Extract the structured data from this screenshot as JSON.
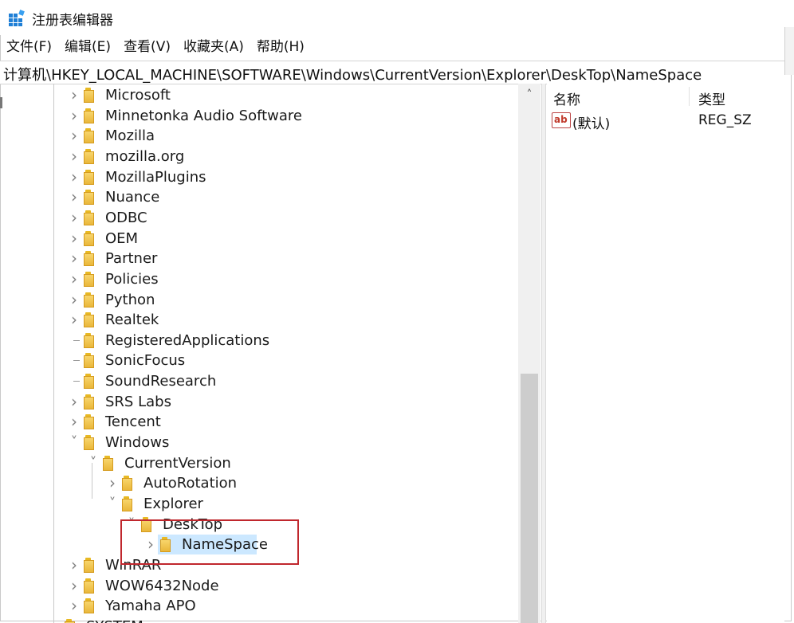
{
  "window": {
    "title": "注册表编辑器"
  },
  "menu": [
    "文件(F)",
    "编辑(E)",
    "查看(V)",
    "收藏夹(A)",
    "帮助(H)"
  ],
  "address": "计算机\\HKEY_LOCAL_MACHINE\\SOFTWARE\\Windows\\CurrentVersion\\Explorer\\DeskTop\\NameSpace",
  "tree": [
    {
      "label": "Microsoft",
      "level": 0,
      "state": "collapsed"
    },
    {
      "label": "Minnetonka Audio Software",
      "level": 0,
      "state": "collapsed"
    },
    {
      "label": "Mozilla",
      "level": 0,
      "state": "collapsed"
    },
    {
      "label": "mozilla.org",
      "level": 0,
      "state": "collapsed"
    },
    {
      "label": "MozillaPlugins",
      "level": 0,
      "state": "collapsed"
    },
    {
      "label": "Nuance",
      "level": 0,
      "state": "collapsed"
    },
    {
      "label": "ODBC",
      "level": 0,
      "state": "collapsed"
    },
    {
      "label": "OEM",
      "level": 0,
      "state": "collapsed"
    },
    {
      "label": "Partner",
      "level": 0,
      "state": "collapsed"
    },
    {
      "label": "Policies",
      "level": 0,
      "state": "collapsed"
    },
    {
      "label": "Python",
      "level": 0,
      "state": "collapsed"
    },
    {
      "label": "Realtek",
      "level": 0,
      "state": "collapsed"
    },
    {
      "label": "RegisteredApplications",
      "level": 0,
      "state": "leaf"
    },
    {
      "label": "SonicFocus",
      "level": 0,
      "state": "leaf"
    },
    {
      "label": "SoundResearch",
      "level": 0,
      "state": "leaf"
    },
    {
      "label": "SRS Labs",
      "level": 0,
      "state": "collapsed"
    },
    {
      "label": "Tencent",
      "level": 0,
      "state": "collapsed"
    },
    {
      "label": "Windows",
      "level": 0,
      "state": "expanded"
    },
    {
      "label": "CurrentVersion",
      "level": 1,
      "state": "expanded"
    },
    {
      "label": "AutoRotation",
      "level": 2,
      "state": "collapsed"
    },
    {
      "label": "Explorer",
      "level": 2,
      "state": "expanded"
    },
    {
      "label": "DeskTop",
      "level": 3,
      "state": "expanded"
    },
    {
      "label": "NameSpace",
      "level": 4,
      "state": "collapsed",
      "selected": true
    },
    {
      "label": "WinRAR",
      "level": 0,
      "state": "collapsed"
    },
    {
      "label": "WOW6432Node",
      "level": 0,
      "state": "collapsed"
    },
    {
      "label": "Yamaha APO",
      "level": 0,
      "state": "collapsed"
    },
    {
      "label": "SYSTEM",
      "level": -1,
      "state": "collapsed"
    }
  ],
  "list": {
    "columns": {
      "name": "名称",
      "type": "类型"
    },
    "rows": [
      {
        "icon": "string-value-icon",
        "icon_text": "ab",
        "name": "(默认)",
        "type": "REG_SZ"
      }
    ]
  },
  "colors": {
    "selection": "#cce8ff",
    "highlight_box": "#c0272d",
    "folder": "#f0c54a"
  }
}
